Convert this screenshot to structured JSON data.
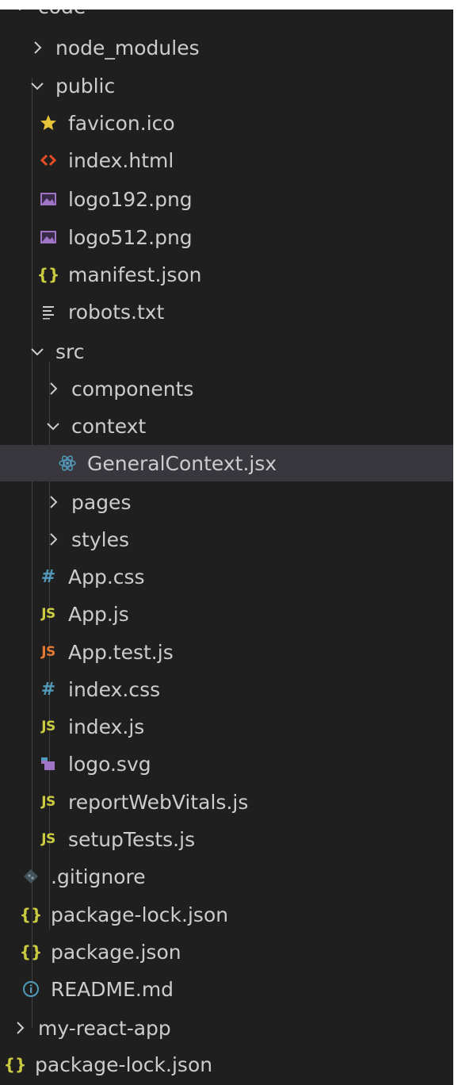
{
  "explorer": {
    "root_label": "code",
    "items": {
      "node_modules": "node_modules",
      "public": "public",
      "favicon": "favicon.ico",
      "index_html": "index.html",
      "logo192": "logo192.png",
      "logo512": "logo512.png",
      "manifest": "manifest.json",
      "robots": "robots.txt",
      "src": "src",
      "components": "components",
      "context": "context",
      "general_context": "GeneralContext.jsx",
      "pages": "pages",
      "styles": "styles",
      "app_css": "App.css",
      "app_js": "App.js",
      "app_test": "App.test.js",
      "index_css": "index.css",
      "index_js": "index.js",
      "logo_svg": "logo.svg",
      "report_web_vitals": "reportWebVitals.js",
      "setup_tests": "setupTests.js",
      "gitignore": ".gitignore",
      "package_lock": "package-lock.json",
      "package_json": "package.json",
      "readme": "README.md",
      "my_react_app": "my-react-app",
      "package_lock_root": "package-lock.json"
    },
    "badges": {
      "js": "JS",
      "hash": "#",
      "braces": "{}"
    },
    "colors": {
      "background": "#1f1f1f",
      "selected_row": "#37373d",
      "text": "#cccccc",
      "js_yellow": "#cbcb41",
      "js_test_red": "#e37933",
      "css_blue": "#519aba",
      "json_yellow": "#cbcb41",
      "html_orange": "#e44d26",
      "image_purple": "#a074c4",
      "react_blue": "#519aba",
      "favicon_star": "#e8c43a",
      "info_blue": "#519aba",
      "git_gray": "#41535b"
    }
  }
}
